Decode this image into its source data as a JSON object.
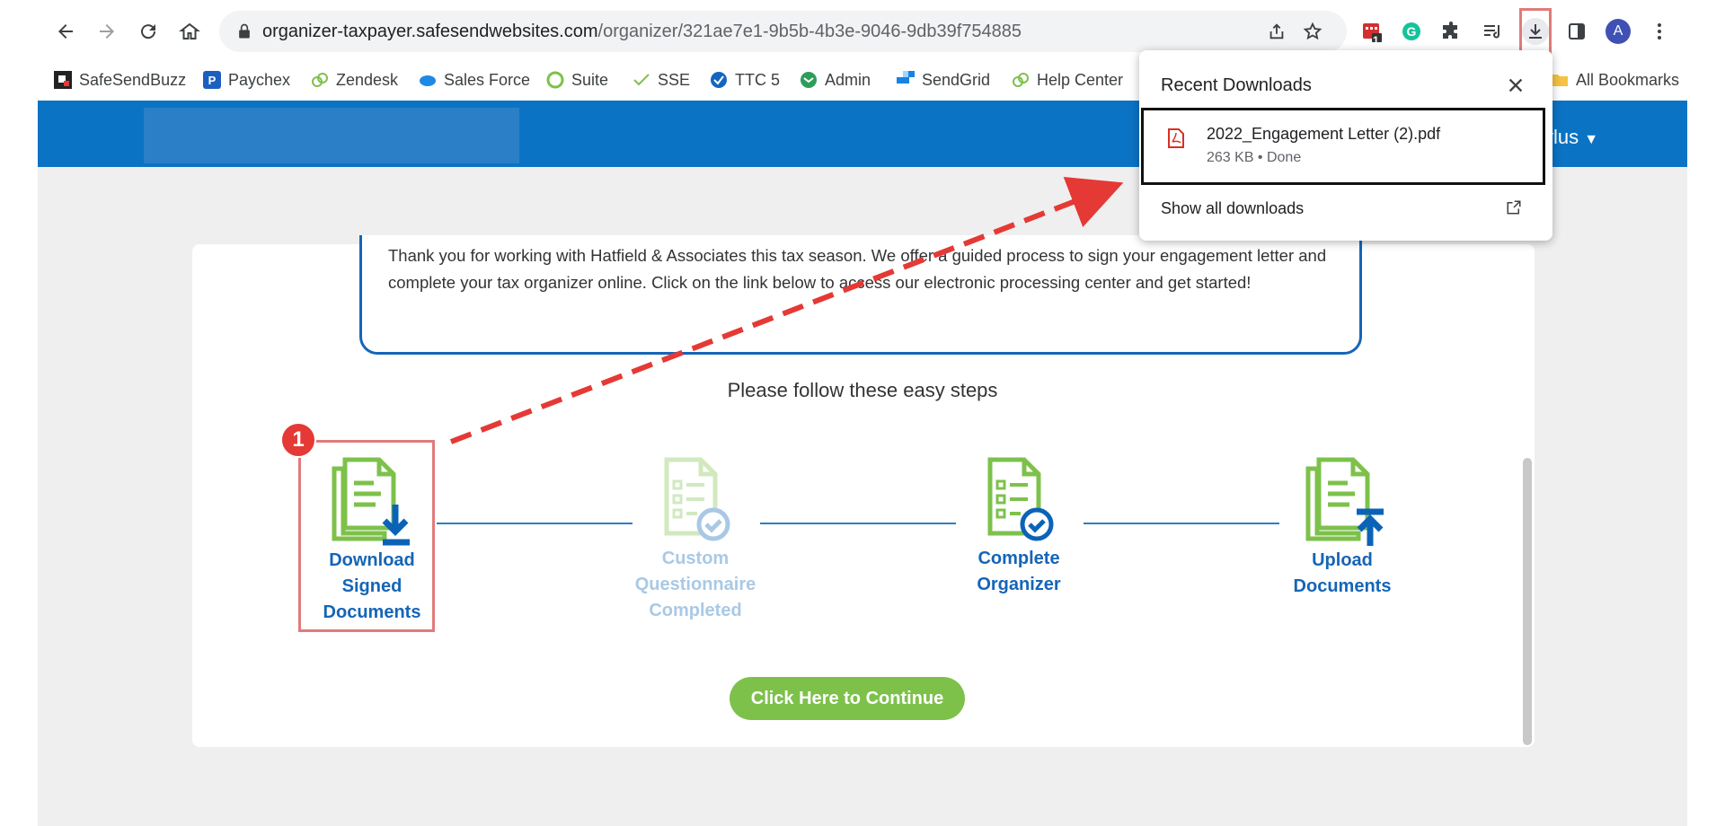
{
  "browser": {
    "url_domain": "organizer-taxpayer.safesendwebsites.com",
    "url_path": "/organizer/321ae7e1-9b5b-4b3e-9046-9db39f754885",
    "profile_initial": "A",
    "extension_badge_count": "1"
  },
  "bookmarks": [
    {
      "label": "SafeSendBuzz",
      "icon": "safesend-buzz-icon"
    },
    {
      "label": "Paychex",
      "icon": "paychex-icon"
    },
    {
      "label": "Zendesk",
      "icon": "zendesk-icon"
    },
    {
      "label": "Sales Force",
      "icon": "salesforce-cloud-icon"
    },
    {
      "label": "Suite",
      "icon": "suite-ring-icon"
    },
    {
      "label": "SSE",
      "icon": "sse-check-icon"
    },
    {
      "label": "TTC 5",
      "icon": "ttc-check-icon"
    },
    {
      "label": "Admin",
      "icon": "admin-mail-icon"
    },
    {
      "label": "SendGrid",
      "icon": "sendgrid-icon"
    },
    {
      "label": "Help Center",
      "icon": "help-center-icon"
    }
  ],
  "all_bookmarks_label": "All Bookmarks",
  "downloads_popup": {
    "title": "Recent Downloads",
    "file_name": "2022_Engagement Letter (2).pdf",
    "file_meta": "263 KB • Done",
    "show_all_label": "Show all downloads"
  },
  "page": {
    "user_name_partial": "ylus",
    "message": "Thank you for working with Hatfield & Associates  this tax season. We offer a guided process to sign your engagement letter and complete your tax organizer online.  Click on the link below to access our electronic processing center and get started!",
    "steps_heading": "Please follow these easy steps",
    "steps": [
      {
        "line1": "Download",
        "line2": "Signed",
        "line3": "Documents",
        "state": "active"
      },
      {
        "line1": "Custom",
        "line2": "Questionnaire",
        "line3": "Completed",
        "state": "disabled"
      },
      {
        "line1": "Complete",
        "line2": "Organizer",
        "line3": "",
        "state": "active"
      },
      {
        "line1": "Upload",
        "line2": "Documents",
        "line3": "",
        "state": "active"
      }
    ],
    "continue_label": "Click Here to Continue"
  },
  "annotation": {
    "badge_number": "1"
  },
  "colors": {
    "brand_blue": "#0b73c4",
    "step_label_blue": "#1565b7",
    "icon_green": "#7dc14b",
    "continue_green": "#7dc14b",
    "annotation_red": "#e53935"
  }
}
